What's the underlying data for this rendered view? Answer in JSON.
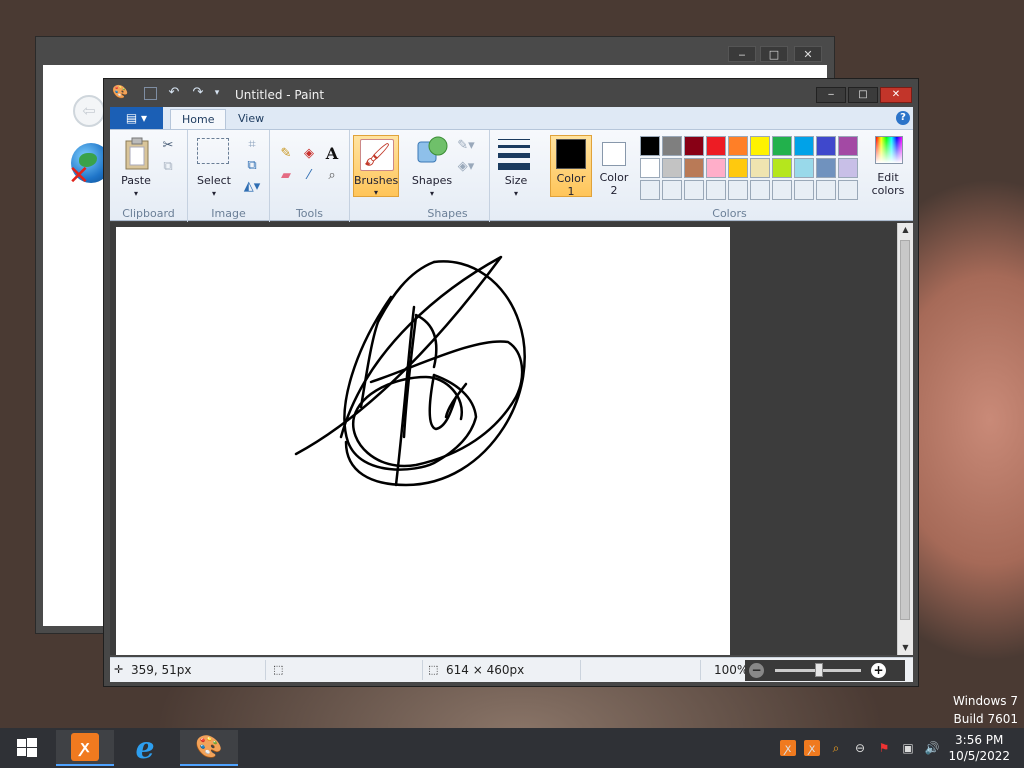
{
  "paint": {
    "title": "Untitled - Paint",
    "tabs": [
      "Home",
      "View"
    ],
    "groups": {
      "clipboard": {
        "label": "Clipboard",
        "paste": "Paste"
      },
      "image": {
        "label": "Image",
        "select": "Select"
      },
      "tools": {
        "label": "Tools"
      },
      "brushes": "Brushes",
      "shapes": {
        "label": "Shapes",
        "shapes": "Shapes"
      },
      "size": "Size",
      "colors": {
        "label": "Colors",
        "color1": "Color\n1",
        "color2": "Color\n2",
        "edit": "Edit\ncolors"
      }
    },
    "palette": [
      [
        "#000000",
        "#7f7f7f",
        "#880015",
        "#ed1c24",
        "#ff7f27",
        "#fff200",
        "#22b14c",
        "#00a2e8",
        "#3f48cc",
        "#a349a4"
      ],
      [
        "#ffffff",
        "#c3c3c3",
        "#b97a57",
        "#ffaec9",
        "#ffc90e",
        "#efe4b0",
        "#b5e61d",
        "#99d9ea",
        "#7092be",
        "#c8bfe7"
      ],
      [
        "#e8eef5",
        "#e8eef5",
        "#e8eef5",
        "#e8eef5",
        "#e8eef5",
        "#e8eef5",
        "#e8eef5",
        "#e8eef5",
        "#e8eef5",
        "#e8eef5"
      ]
    ],
    "color1": "#000000",
    "color2": "#ffffff",
    "status": {
      "cursor": "359, 51px",
      "canvas_size": "614 × 460px",
      "zoom": "100%"
    }
  },
  "taskbar": {
    "time": "3:56 PM",
    "date": "10/5/2022"
  },
  "watermark": {
    "line1": "Windows 7",
    "line2": "Build 7601"
  }
}
